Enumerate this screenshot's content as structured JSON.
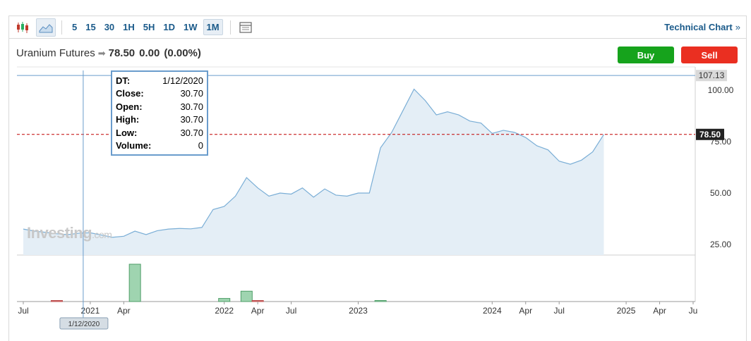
{
  "toolbar": {
    "timeframes": [
      "5",
      "15",
      "30",
      "1H",
      "5H",
      "1D",
      "1W",
      "1M"
    ],
    "active_timeframe": "1M",
    "technical_link": "Technical Chart",
    "technical_chevron": "»"
  },
  "header": {
    "instrument": "Uranium Futures",
    "price": "78.50",
    "change": "0.00",
    "change_pct": "(0.00%)"
  },
  "actions": {
    "buy_label": "Buy",
    "sell_label": "Sell"
  },
  "tooltip": {
    "rows": [
      {
        "k": "DT:",
        "v": "1/12/2020"
      },
      {
        "k": "Close:",
        "v": "30.70"
      },
      {
        "k": "Open:",
        "v": "30.70"
      },
      {
        "k": "High:",
        "v": "30.70"
      },
      {
        "k": "Low:",
        "v": "30.70"
      },
      {
        "k": "Volume:",
        "v": "0"
      }
    ]
  },
  "watermark": {
    "main": "Investing",
    "suffix": ".com"
  },
  "colors": {
    "line": "#7aaed6",
    "area": "#e4eef6",
    "last_price": "#c00000",
    "vol_up": "#9fd4b0",
    "vol_down": "#e07a7a"
  },
  "chart_data": {
    "type": "area",
    "x": [
      "2020-07",
      "2020-08",
      "2020-09",
      "2020-10",
      "2020-11",
      "2020-12",
      "2021-01",
      "2021-02",
      "2021-03",
      "2021-04",
      "2021-05",
      "2021-06",
      "2021-07",
      "2021-08",
      "2021-09",
      "2021-10",
      "2021-11",
      "2021-12",
      "2022-01",
      "2022-02",
      "2022-03",
      "2022-04",
      "2022-05",
      "2022-06",
      "2022-07",
      "2022-08",
      "2022-09",
      "2022-10",
      "2022-11",
      "2022-12",
      "2023-01",
      "2023-02",
      "2023-03",
      "2023-04",
      "2023-05",
      "2023-06",
      "2023-07",
      "2023-08",
      "2023-09",
      "2023-10",
      "2023-11",
      "2023-12",
      "2024-01",
      "2024-02",
      "2024-03",
      "2024-04",
      "2024-05",
      "2024-06",
      "2024-07",
      "2024-08",
      "2024-09",
      "2024-10",
      "2024-11",
      "2024-12",
      "2025-01",
      "2025-02",
      "2025-03",
      "2025-04",
      "2025-05",
      "2025-06"
    ],
    "close": [
      32.5,
      31.5,
      30.9,
      30.2,
      29.8,
      30.5,
      30.7,
      29.6,
      28.5,
      29.0,
      31.5,
      29.8,
      31.7,
      32.5,
      32.8,
      32.6,
      33.3,
      42.0,
      43.5,
      48.5,
      57.5,
      52.5,
      48.5,
      50.0,
      49.5,
      52.5,
      48.0,
      52.0,
      49.0,
      48.5,
      50.0,
      50.0,
      72.0,
      79.5,
      90.0,
      100.5,
      95.0,
      88.0,
      89.5,
      88.0,
      85.0,
      84.0,
      79.0,
      80.5,
      79.5,
      77.0,
      73.0,
      71.0,
      65.5,
      64.0,
      66.0,
      70.0,
      78.5
    ],
    "volume_up": {
      "2021-05": 18,
      "2022-01": 1.5,
      "2022-03": 5,
      "2023-03": 0.2
    },
    "volume_down": {
      "2020-10": 0.3,
      "2022-04": 0.5
    },
    "last_price": 78.5,
    "high_marker": 107.13,
    "y_ticks": [
      100.0,
      75.0,
      50.0,
      25.0
    ],
    "y_tick_labels": [
      "100.00",
      "75.00",
      "50.00",
      "25.00"
    ],
    "x_tick_labels": [
      "Jul",
      "2021",
      "Apr",
      "2022",
      "Apr",
      "Jul",
      "2023",
      "2024",
      "Apr",
      "Jul",
      "2025",
      "Apr",
      "Ju"
    ],
    "x_tick_months": [
      "2020-07",
      "2021-01",
      "2021-04",
      "2022-01",
      "2022-04",
      "2022-07",
      "2023-01",
      "2024-01",
      "2024-04",
      "2024-07",
      "2025-01",
      "2025-04",
      "2025-07"
    ],
    "crosshair_date": "1/12/2020",
    "crosshair_month": "2021-01",
    "last_price_label": "78.50",
    "high_marker_label": "107.13",
    "ylim": [
      20,
      110
    ]
  }
}
